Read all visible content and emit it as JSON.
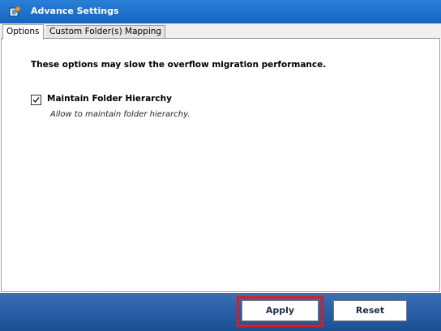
{
  "window": {
    "title": "Advance Settings",
    "app_icon": "app-logo-icon"
  },
  "tabs": [
    {
      "label": "Options",
      "active": true
    },
    {
      "label": "Custom Folder(s) Mapping",
      "active": false
    }
  ],
  "options": {
    "warning": "These options may slow the overflow migration performance.",
    "maintain_hierarchy": {
      "label": "Maintain Folder Hierarchy",
      "description": "Allow to maintain folder hierarchy.",
      "checked": true
    }
  },
  "buttons": {
    "apply_label": "Apply",
    "reset_label": "Reset"
  },
  "colors": {
    "titlebar": "#1565c0",
    "bottombar": "#2a5ea6",
    "highlight": "#d0202a"
  }
}
